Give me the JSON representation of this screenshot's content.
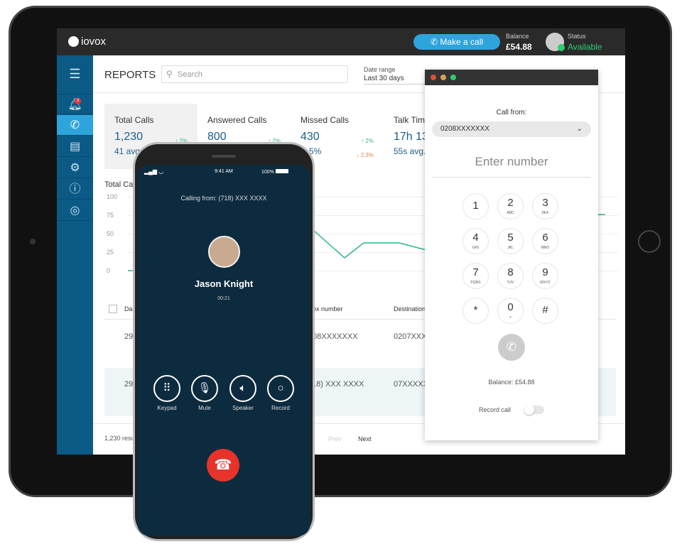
{
  "header": {
    "logo": "iovox",
    "make_call": "Make a call",
    "balance_label": "Balance",
    "balance": "£54.88",
    "status_label": "Status",
    "status": "Available"
  },
  "sidebar": {
    "items": [
      "menu-icon",
      "bell-icon",
      "phone-icon",
      "table-icon",
      "gear-icon",
      "help-icon",
      "user-icon"
    ],
    "badge": "3"
  },
  "reports": {
    "title": "REPORTS",
    "search_placeholder": "Search",
    "date_label": "Date range",
    "date_value": "Last 30 days"
  },
  "stats": [
    {
      "label": "Total Calls",
      "value": "1,230",
      "avg": "41 avg",
      "change": "↑ 2%"
    },
    {
      "label": "Answered Calls",
      "value": "800",
      "avg": "",
      "change": "↑ 2%"
    },
    {
      "label": "Missed Calls",
      "value": "430",
      "avg": "5%",
      "change": "↑ 2%",
      "change2": "↓ 2.3%"
    },
    {
      "label": "Talk Tim",
      "value": "17h 13",
      "avg": "55s avg."
    }
  ],
  "chart": {
    "title": "Total Ca",
    "yticks": [
      "100",
      "75",
      "50",
      "25",
      "0"
    ]
  },
  "table": {
    "headers": [
      "Da",
      "ox number",
      "Destination"
    ],
    "rows": [
      [
        "29",
        "08XXXXXXX",
        "0207XXX"
      ],
      [
        "29",
        "18) XXX XXXX",
        "07XXXXX"
      ]
    ],
    "results": "1,230 resu",
    "prev": "Prev",
    "next": "Next"
  },
  "phone": {
    "time": "9:41 AM",
    "battery": "100%",
    "calling_from": "Calling from: (718) XXX XXXX",
    "name": "Jason Knight",
    "duration": "00:21",
    "controls": [
      "Keypad",
      "Mute",
      "Speaker",
      "Record"
    ]
  },
  "dialer": {
    "call_from_label": "Call from:",
    "call_from": "0208XXXXXXX",
    "placeholder": "Enter number",
    "keys": [
      [
        "1",
        ""
      ],
      [
        "2",
        "ABC"
      ],
      [
        "3",
        "DEF"
      ],
      [
        "4",
        "GHI"
      ],
      [
        "5",
        "JKL"
      ],
      [
        "6",
        "MNO"
      ],
      [
        "7",
        "PQRS"
      ],
      [
        "8",
        "TUV"
      ],
      [
        "9",
        "WXYZ"
      ],
      [
        "*",
        ""
      ],
      [
        "0",
        "+"
      ],
      [
        "#",
        ""
      ]
    ],
    "balance": "Balance: £54.88",
    "record_label": "Record call",
    "record_on": false
  },
  "colors": {
    "accent": "#2ea4dd",
    "sidebar": "#0b5a86",
    "available": "#2ecc71",
    "phone_bg": "#0d2b3e",
    "hangup": "#e8332b",
    "chart_line": "#2bb58a"
  }
}
